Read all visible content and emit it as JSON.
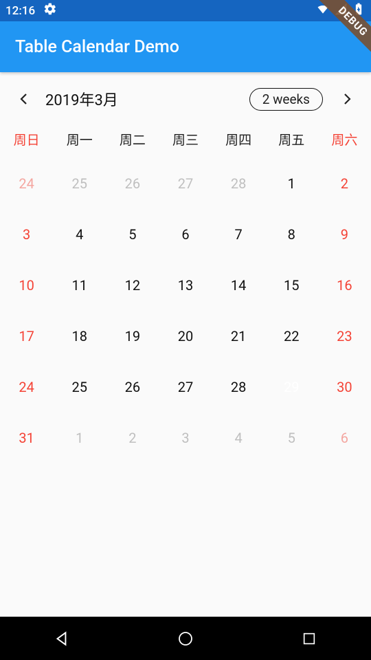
{
  "status": {
    "time": "12:16"
  },
  "app": {
    "title": "Table Calendar Demo"
  },
  "debug": {
    "label": "DEBUG"
  },
  "calendar": {
    "month_label": "2019年3月",
    "format_label": "2 weeks",
    "weekdays": [
      "周日",
      "周一",
      "周二",
      "周三",
      "周四",
      "周五",
      "周六"
    ],
    "rows": [
      [
        {
          "d": "24",
          "out": true,
          "we": true
        },
        {
          "d": "25",
          "out": true
        },
        {
          "d": "26",
          "out": true
        },
        {
          "d": "27",
          "out": true
        },
        {
          "d": "28",
          "out": true
        },
        {
          "d": "1"
        },
        {
          "d": "2",
          "we": true
        }
      ],
      [
        {
          "d": "3",
          "we": true
        },
        {
          "d": "4"
        },
        {
          "d": "5"
        },
        {
          "d": "6"
        },
        {
          "d": "7"
        },
        {
          "d": "8"
        },
        {
          "d": "9",
          "we": true
        }
      ],
      [
        {
          "d": "10",
          "we": true
        },
        {
          "d": "11"
        },
        {
          "d": "12"
        },
        {
          "d": "13"
        },
        {
          "d": "14"
        },
        {
          "d": "15"
        },
        {
          "d": "16",
          "we": true
        }
      ],
      [
        {
          "d": "17",
          "we": true
        },
        {
          "d": "18"
        },
        {
          "d": "19"
        },
        {
          "d": "20"
        },
        {
          "d": "21"
        },
        {
          "d": "22"
        },
        {
          "d": "23",
          "we": true
        }
      ],
      [
        {
          "d": "24",
          "we": true
        },
        {
          "d": "25"
        },
        {
          "d": "26"
        },
        {
          "d": "27"
        },
        {
          "d": "28"
        },
        {
          "d": "29",
          "sel": true
        },
        {
          "d": "30",
          "we": true
        }
      ],
      [
        {
          "d": "31",
          "we": true
        },
        {
          "d": "1",
          "out": true
        },
        {
          "d": "2",
          "out": true
        },
        {
          "d": "3",
          "out": true
        },
        {
          "d": "4",
          "out": true
        },
        {
          "d": "5",
          "out": true
        },
        {
          "d": "6",
          "out": true,
          "we": true
        }
      ]
    ]
  }
}
